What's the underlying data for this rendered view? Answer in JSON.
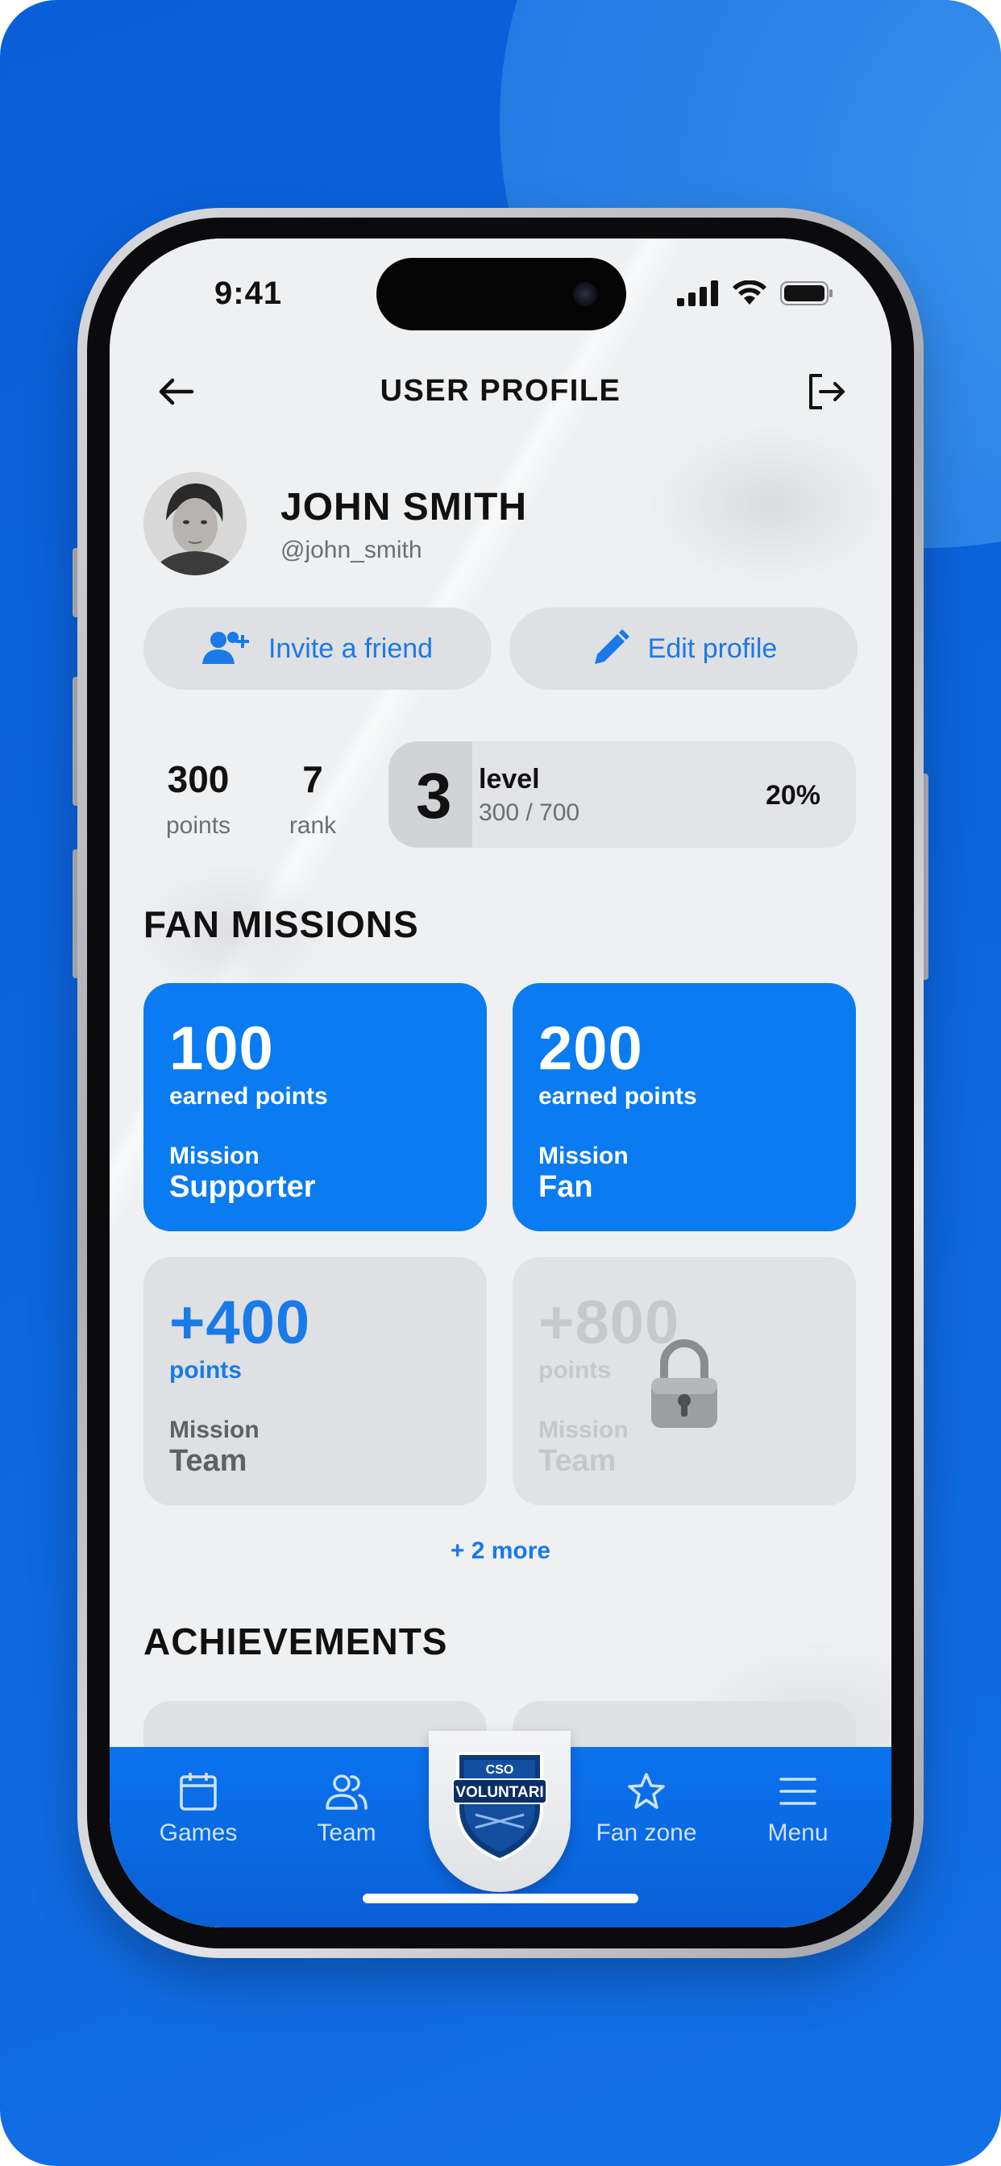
{
  "status_bar": {
    "time": "9:41"
  },
  "header": {
    "title": "USER PROFILE"
  },
  "user": {
    "name": "JOHN SMITH",
    "handle": "@john_smith"
  },
  "actions": {
    "invite_label": "Invite a friend",
    "edit_label": "Edit profile"
  },
  "stats": {
    "points_value": "300",
    "points_label": "points",
    "rank_value": "7",
    "rank_label": "rank"
  },
  "level": {
    "number": "3",
    "label": "level",
    "progress_text": "300 / 700",
    "percent_text": "20%",
    "fill_fraction": 0.18
  },
  "fan_missions": {
    "title": "FAN MISSIONS",
    "cards": [
      {
        "points": "100",
        "sub": "earned points",
        "mission_label": "Mission",
        "name": "Supporter",
        "state": "completed"
      },
      {
        "points": "200",
        "sub": "earned points",
        "mission_label": "Mission",
        "name": "Fan",
        "state": "completed"
      },
      {
        "points": "+400",
        "sub": "points",
        "mission_label": "Mission",
        "name": "Team",
        "state": "available"
      },
      {
        "points": "+800",
        "sub": "points",
        "mission_label": "Mission",
        "name": "Team",
        "state": "locked"
      }
    ],
    "more_label": "+ 2 more"
  },
  "achievements": {
    "title": "ACHIEVEMENTS"
  },
  "tabbar": {
    "games_label": "Games",
    "team_label": "Team",
    "fanzone_label": "Fan zone",
    "menu_label": "Menu",
    "logo_line1": "CSO",
    "logo_line2": "VOLUNTARI"
  },
  "colors": {
    "accent": "#0a7bf0",
    "background_blue": "#0b64dd"
  }
}
